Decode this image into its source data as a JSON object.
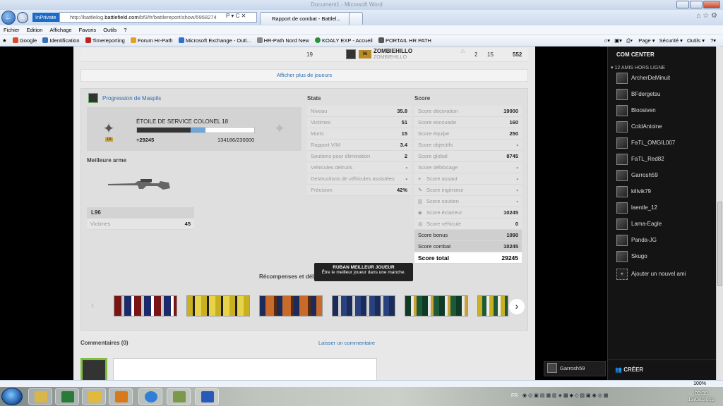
{
  "window": {
    "title": "Document1 - Microsoft Word"
  },
  "address": {
    "inprivate": "InPrivate",
    "url_prefix": "http://battlelog.",
    "url_domain": "battlefield.com",
    "url_rest": "/bf3/fr/battlereport/show/5958274",
    "url_controls": "P ▾ C ✕"
  },
  "tabs": [
    {
      "label": "Rapport de combat - Battlel..."
    }
  ],
  "menu": [
    "Fichier",
    "Edition",
    "Affichage",
    "Favoris",
    "Outils",
    "?"
  ],
  "favorites": [
    {
      "label": "Google",
      "color": "#d94a2a"
    },
    {
      "label": "Identification",
      "color": "#3b6fb6"
    },
    {
      "label": "Timereporting",
      "color": "#c02020"
    },
    {
      "label": "Forum Hr-Path",
      "color": "#e2a125"
    },
    {
      "label": "Microsoft Exchange - Outl...",
      "color": "#2f6fd0"
    },
    {
      "label": "HR-Path Nord New",
      "color": "#888888"
    },
    {
      "label": "KOALY EXP - Accueil",
      "color": "#2a8f3a"
    },
    {
      "label": "PORTAIL HR PATH",
      "color": "#555555"
    }
  ],
  "commandbar": [
    "Page ▾",
    "Sécurité ▾",
    "Outils ▾"
  ],
  "player_row": {
    "rank": "19",
    "rank_badge": "96",
    "name": "ZOMBIEHILLO",
    "sub": "ZOMBIEHILLO",
    "k": "2",
    "d": "15",
    "score": "552"
  },
  "more_players": "Afficher plus de joueurs",
  "progression": {
    "title": "Progression de Maspils",
    "rank_title": "ÉTOILE DE SERVICE COLONEL 18",
    "rank_badge": "18",
    "gain": "+29245",
    "progress_text": "134186/230000",
    "progress_fraction": 0.583,
    "gain_fraction": 0.127
  },
  "best_weapon": {
    "heading": "Meilleure arme",
    "name": "L96",
    "stat_label": "Victimes",
    "stat_value": "45"
  },
  "stats": {
    "heading": "Stats",
    "rows": [
      {
        "label": "Niveau",
        "value": "35.8"
      },
      {
        "label": "Victimes",
        "value": "51"
      },
      {
        "label": "Morts",
        "value": "15"
      },
      {
        "label": "Rapport V/M",
        "value": "3.4"
      },
      {
        "label": "Soutiens pour élimination",
        "value": "2"
      },
      {
        "label": "Véhicules détruits",
        "value": "-"
      },
      {
        "label": "Destructions de véhicules assistées",
        "value": "-"
      },
      {
        "label": "Précision",
        "value": "42%"
      }
    ]
  },
  "score": {
    "heading": "Score",
    "rows": [
      {
        "label": "Score décoration",
        "value": "19000"
      },
      {
        "label": "Score escouade",
        "value": "160"
      },
      {
        "label": "Score équipe",
        "value": "250"
      },
      {
        "label": "Score objectifs",
        "value": "-"
      },
      {
        "label": "Score global",
        "value": "8745"
      },
      {
        "label": "Score déblocage",
        "value": "-"
      },
      {
        "label": "Score assaut",
        "value": "-"
      },
      {
        "label": "Score ingénieur",
        "value": "-"
      },
      {
        "label": "Score soutien",
        "value": "-"
      },
      {
        "label": "Score éclaireur",
        "value": "10245"
      },
      {
        "label": "Score véhicule",
        "value": "0"
      },
      {
        "label": "Score bonus",
        "value": "1090"
      },
      {
        "label": "Score combat",
        "value": "10245"
      },
      {
        "label": "Score total",
        "value": "29245"
      }
    ]
  },
  "awards": {
    "heading": "Récompenses et déb",
    "tooltip_title": "RUBAN MEILLEUR JOUEUR",
    "tooltip_text": "Être le meilleur joueur dans une manche."
  },
  "comments": {
    "heading": "Commentaires (0)",
    "add": "Laisser un commentaire"
  },
  "sidebar": {
    "heading": "COM CENTER",
    "section": "12 AMIS HORS LIGNE",
    "friends": [
      "ArcherDeMinuit",
      "BFdergetsu",
      "Bloosiven",
      "ColdAntoine",
      "FaTL_OMGIL007",
      "FaTL_Red82",
      "Garrosh59",
      "killvik79",
      "laentle_12",
      "Lama-Eagle",
      "Panda-JG",
      "Skugo"
    ],
    "add_friend": "Ajouter un nouvel ami",
    "create": "CRÉER",
    "me": "Garrosh59"
  },
  "status": {
    "zoom": "100%"
  },
  "taskbar": {
    "lang": "FR",
    "time": "09:39",
    "date": "13/08/2012"
  }
}
